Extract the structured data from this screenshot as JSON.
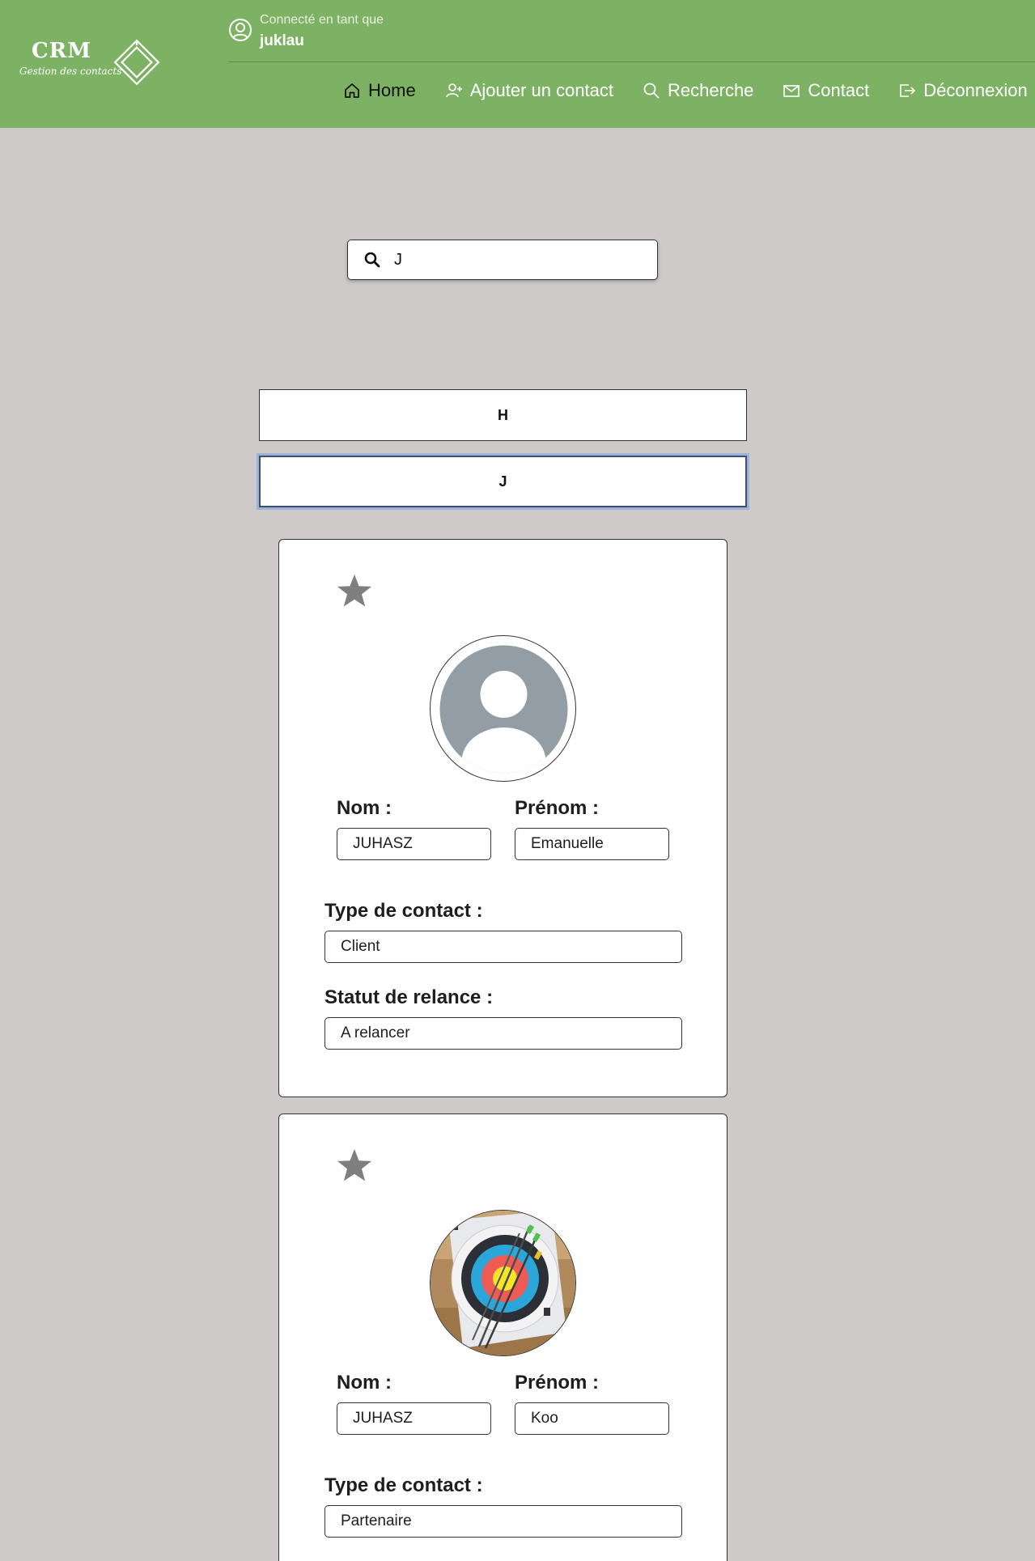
{
  "logo": {
    "title": "CRM",
    "subtitle": "Gestion des contacts"
  },
  "user": {
    "caption": "Connecté en tant que",
    "name": "juklau"
  },
  "nav": [
    {
      "label": "Home",
      "icon": "home-icon",
      "active": true
    },
    {
      "label": "Ajouter un contact",
      "icon": "add-user-icon"
    },
    {
      "label": "Recherche",
      "icon": "search-icon"
    },
    {
      "label": "Contact",
      "icon": "mail-icon"
    },
    {
      "label": "Déconnexion",
      "icon": "logout-icon"
    }
  ],
  "search": {
    "value": "J",
    "icon": "search-icon"
  },
  "letters": [
    "H",
    "J"
  ],
  "contacts": [
    {
      "favorite_icon": "star-icon",
      "avatar": "default-avatar",
      "nom_label": "Nom :",
      "nom": "JUHASZ",
      "prenom_label": "Prénom :",
      "prenom": "Emanuelle",
      "type_label": "Type de contact :",
      "type": "Client",
      "statut_label": "Statut de relance :",
      "statut": "A relancer"
    },
    {
      "favorite_icon": "star-icon",
      "avatar": "archery-target-photo",
      "nom_label": "Nom :",
      "nom": "JUHASZ",
      "prenom_label": "Prénom :",
      "prenom": "Koo",
      "type_label": "Type de contact :",
      "type": "Partenaire"
    }
  ],
  "colors": {
    "header": "#7db264",
    "background": "#cfcaca",
    "focus_ring": "#9fb1d4",
    "star": "#7f7f7f",
    "avatar_default": "#929da6"
  }
}
